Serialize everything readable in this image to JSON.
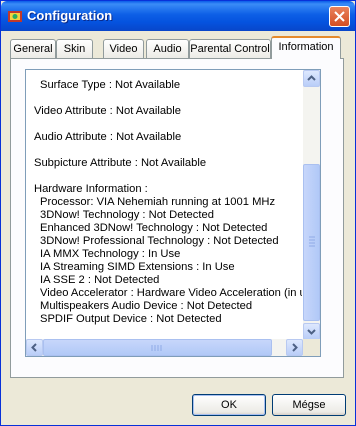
{
  "window": {
    "title": "Configuration"
  },
  "tabs": [
    {
      "label": "General"
    },
    {
      "label": "Skin"
    },
    {
      "label": "Video"
    },
    {
      "label": "Audio"
    },
    {
      "label": "Parental Control"
    },
    {
      "label": "Information"
    }
  ],
  "info_lines": [
    "Surface Type : Not Available",
    "Video Attribute : Not Available",
    "Audio Attribute : Not Available",
    "Subpicture Attribute : Not Available",
    "Hardware Information :",
    "Processor:  VIA Nehemiah running at 1001 MHz",
    "3DNow! Technology :  Not Detected",
    "Enhanced 3DNow! Technology :  Not Detected",
    "3DNow! Professional Technology :  Not Detected",
    "IA MMX Technology :  In Use",
    "IA Streaming SIMD Extensions :  In Use",
    "IA SSE 2 :  Not Detected",
    "Video Accelerator :  Hardware Video Acceleration (in use)",
    "Multispeakers Audio Device :  Not Detected",
    "SPDIF Output Device :  Not Detected"
  ],
  "buttons": {
    "ok": "OK",
    "cancel": "Mégse"
  }
}
